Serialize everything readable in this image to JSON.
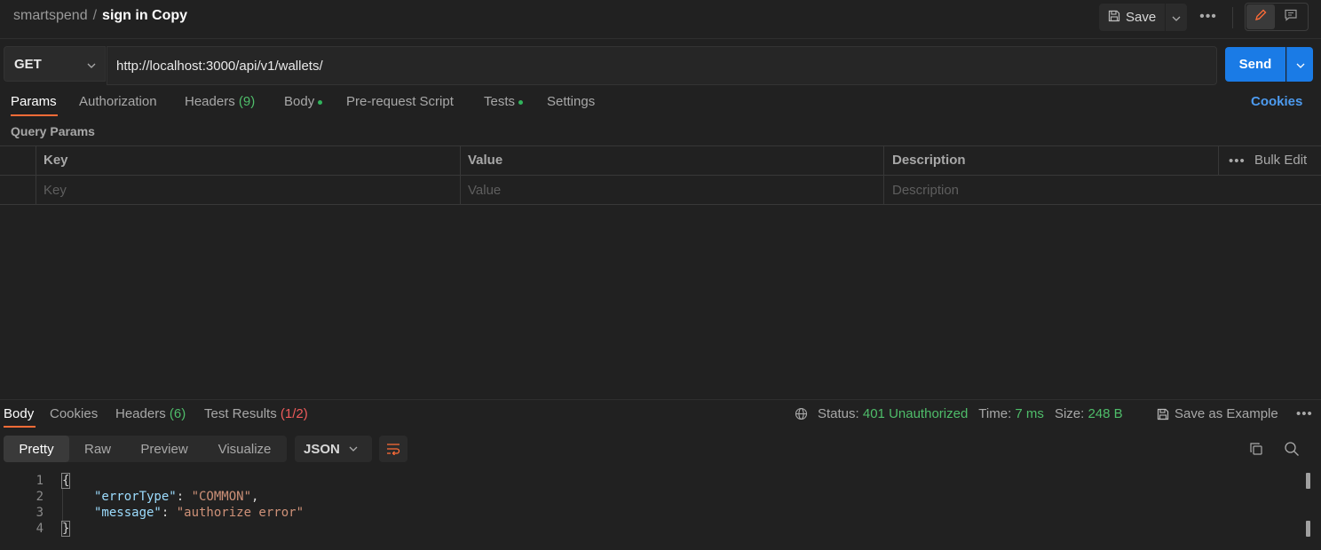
{
  "breadcrumb": {
    "workspace": "smartspend",
    "separator": "/",
    "request": "sign in Copy"
  },
  "toolbar": {
    "save_label": "Save",
    "more": "•••"
  },
  "request": {
    "method": "GET",
    "url": "http://localhost:3000/api/v1/wallets/",
    "send_label": "Send"
  },
  "request_tabs": {
    "params": "Params",
    "authorization": "Authorization",
    "headers": "Headers",
    "headers_count": "(9)",
    "body": "Body",
    "prerequest": "Pre-request Script",
    "tests": "Tests",
    "settings": "Settings",
    "cookies": "Cookies"
  },
  "query_params": {
    "title": "Query Params",
    "columns": {
      "key": "Key",
      "value": "Value",
      "description": "Description"
    },
    "bulk_edit": "Bulk Edit",
    "placeholders": {
      "key": "Key",
      "value": "Value",
      "description": "Description"
    }
  },
  "response": {
    "tabs": {
      "body": "Body",
      "cookies": "Cookies",
      "headers": "Headers",
      "headers_count": "(6)",
      "test_results": "Test Results",
      "test_results_count": "(1/2)"
    },
    "status_label": "Status:",
    "status_value": "401 Unauthorized",
    "time_label": "Time:",
    "time_value": "7 ms",
    "size_label": "Size:",
    "size_value": "248 B",
    "save_example": "Save as Example",
    "views": {
      "pretty": "Pretty",
      "raw": "Raw",
      "preview": "Preview",
      "visualize": "Visualize"
    },
    "format": "JSON",
    "code": {
      "line_numbers": [
        "1",
        "2",
        "3",
        "4"
      ],
      "open_brace": "{",
      "close_brace": "}",
      "k1": "\"errorType\"",
      "v1": "\"COMMON\"",
      "k2": "\"message\"",
      "v2": "\"authorize error\""
    }
  },
  "colors": {
    "accent": "#ff6c37",
    "send": "#1a7be6",
    "success": "#4fbd6a",
    "error": "#ef5b5b",
    "link": "#4d9bef"
  }
}
